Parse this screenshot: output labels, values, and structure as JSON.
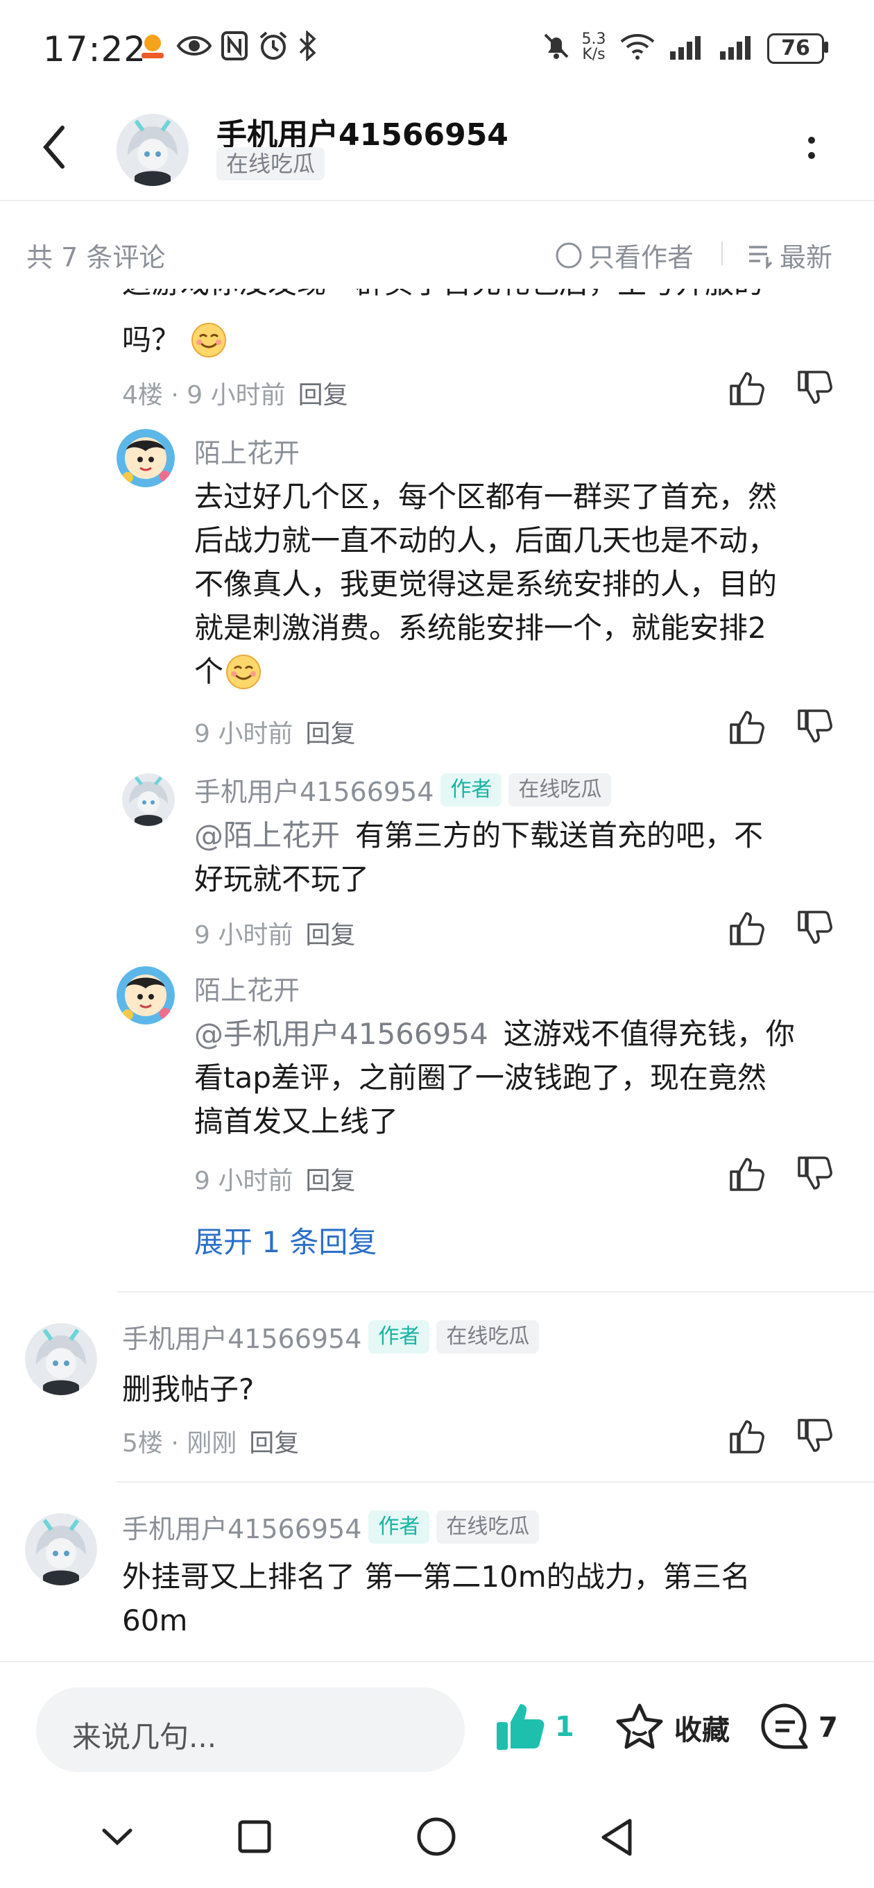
{
  "status": {
    "time": "17:22",
    "net_speed_top": "5.3",
    "net_speed_bottom": "K/s",
    "battery": "76"
  },
  "header": {
    "title": "手机用户41566954",
    "tag": "在线吃瓜"
  },
  "comments_bar": {
    "count_label": "共 7 条评论",
    "only_author": "只看作者",
    "sort": "最新"
  },
  "comments": [
    {
      "text_partial": "这游戏你没发现一群买了首充礼包后，生号开服的",
      "text_line2": "吗？",
      "floor": "4楼",
      "time": "9 小时前",
      "reply": "回复",
      "replies": [
        {
          "name": "陌上花开",
          "text_lines": [
            "去过好几个区，每个区都有一群买了首充，然",
            "后战力就一直不动的人，后面几天也是不动，",
            "不像真人，我更觉得这是系统安排的人，目的",
            "就是刺激消费。系统能安排一个，就能安排2",
            "个"
          ],
          "time": "9 小时前",
          "reply": "回复"
        },
        {
          "name": "手机用户41566954",
          "author_badge": "作者",
          "tag": "在线吃瓜",
          "mention": "@陌上花开",
          "text_line1": "有第三方的下载送首充的吧，不",
          "text_line2": "好玩就不玩了",
          "time": "9 小时前",
          "reply": "回复"
        },
        {
          "name": "陌上花开",
          "mention": "@手机用户41566954",
          "text_line1": "这游戏不值得充钱，你",
          "text_line2": "看tap差评，之前圈了一波钱跑了，现在竟然",
          "text_line3": "搞首发又上线了",
          "time": "9 小时前",
          "reply": "回复"
        }
      ],
      "expand": "展开 1 条回复"
    },
    {
      "name": "手机用户41566954",
      "author_badge": "作者",
      "tag": "在线吃瓜",
      "text": "删我帖子?",
      "floor": "5楼",
      "time": "刚刚",
      "reply": "回复"
    },
    {
      "name": "手机用户41566954",
      "author_badge": "作者",
      "tag": "在线吃瓜",
      "text_line1": "外挂哥又上排名了  第一第二10m的战力，第三名",
      "text_line2": "60m"
    }
  ],
  "bottom": {
    "input_placeholder": "来说几句...",
    "like_count": "1",
    "favorite_label": "收藏",
    "comment_count": "7"
  },
  "colors": {
    "accent_teal": "#1fbfae",
    "link_blue": "#2a6fc9",
    "text_grey": "#8b9098"
  },
  "icons": [
    "back-icon",
    "more-icon",
    "thumb-up-icon",
    "thumb-down-icon",
    "star-icon",
    "comment-icon",
    "chevron-down-icon",
    "square-icon",
    "circle-icon",
    "triangle-back-icon"
  ]
}
